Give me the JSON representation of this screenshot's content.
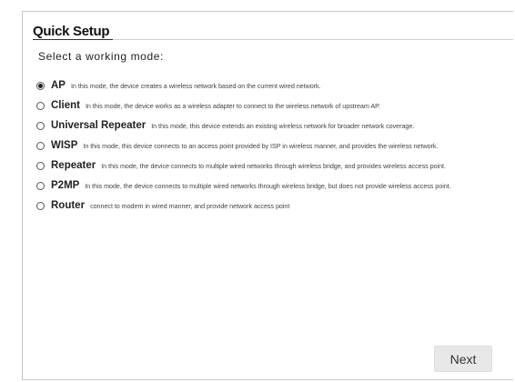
{
  "panel": {
    "title": "Quick Setup",
    "prompt": "Select a working mode:"
  },
  "modes": [
    {
      "name": "AP",
      "checked": true,
      "description": "In this mode, the device creates a wireless network based on the current wired network."
    },
    {
      "name": "Client",
      "checked": false,
      "description": "In this mode, the device works as a wireless adapter to connect to the wireless network of upstream AP."
    },
    {
      "name": "Universal Repeater",
      "checked": false,
      "description": "In this mode, this device extends an existing wireless network for broader network coverage."
    },
    {
      "name": "WISP",
      "checked": false,
      "description": "In this mode, this device connects to an access point provided by ISP in wireless manner, and provides the wireless network."
    },
    {
      "name": "Repeater",
      "checked": false,
      "description": "In this mode, the device connects to multiple wired networks through wireless bridge, and provides wireless access point."
    },
    {
      "name": "P2MP",
      "checked": false,
      "description": "In this mode, the device connects to multiple wired networks through wireless bridge, but does not provide wireless access point."
    },
    {
      "name": "Router",
      "checked": false,
      "description": "connect to modem in wired manner, and provide network access point"
    }
  ],
  "actions": {
    "next_label": "Next"
  }
}
